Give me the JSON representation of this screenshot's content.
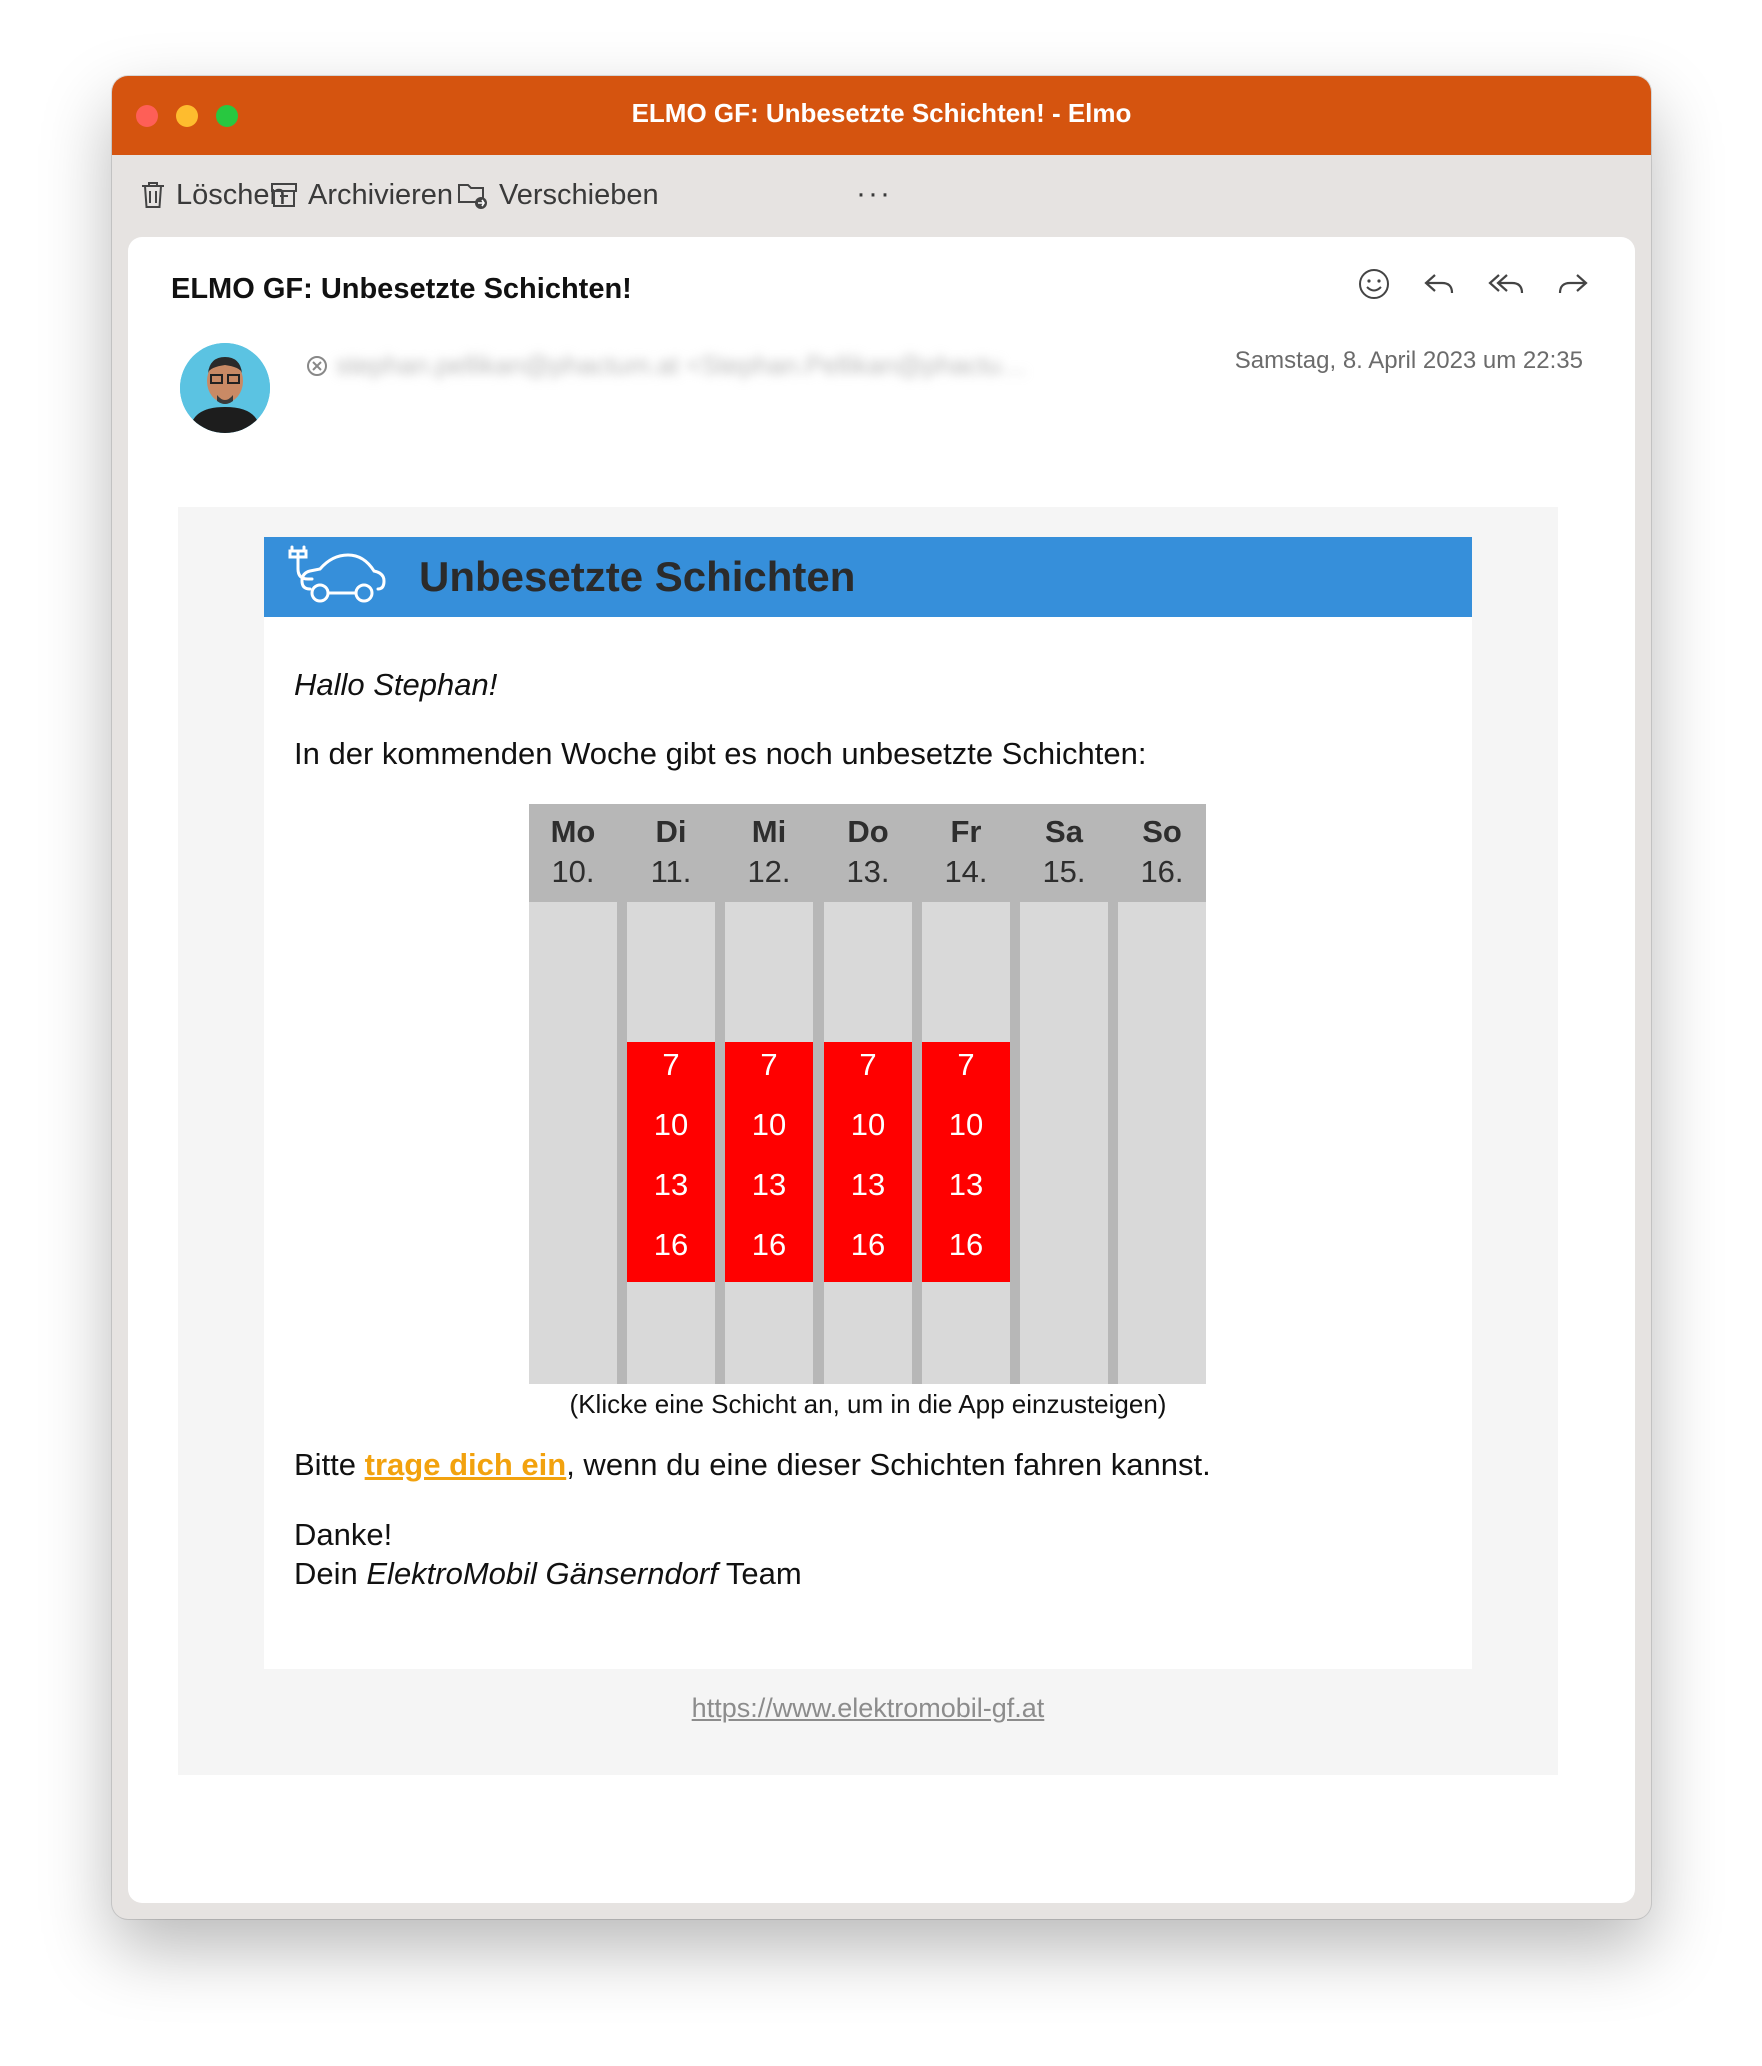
{
  "window": {
    "title": "ELMO GF: Unbesetzte Schichten! - Elmo"
  },
  "toolbar": {
    "delete_label": "Löschen",
    "archive_label": "Archivieren",
    "move_label": "Verschieben",
    "more_label": "···"
  },
  "message": {
    "subject": "ELMO GF: Unbesetzte Schichten!",
    "sender": "stephan.pellikan@phactum.at <Stephan.Pellikan@phactu…",
    "date": "Samstag, 8. April 2023 um 22:35"
  },
  "email": {
    "banner_title": "Unbesetzte Schichten",
    "greeting": "Hallo Stephan!",
    "intro": "In der kommenden Woche gibt es noch unbesetzte Schichten:",
    "caption": "(Klicke eine Schicht an, um in die App einzusteigen)",
    "bitte_prefix": "Bitte ",
    "bitte_link": "trage dich ein",
    "bitte_suffix": ", wenn du eine dieser Schichten fahren kannst.",
    "thanks": "Danke!",
    "sign_prefix": "Dein ",
    "sign_team": "ElektroMobil Gänserndorf",
    "sign_suffix": " Team",
    "footer_url": "https://www.elektromobil-gf.at"
  },
  "calendar": {
    "days": [
      {
        "name": "Mo",
        "date": "10.",
        "shifts": []
      },
      {
        "name": "Di",
        "date": "11.",
        "shifts": [
          "7",
          "10",
          "13",
          "16"
        ]
      },
      {
        "name": "Mi",
        "date": "12.",
        "shifts": [
          "7",
          "10",
          "13",
          "16"
        ]
      },
      {
        "name": "Do",
        "date": "13.",
        "shifts": [
          "7",
          "10",
          "13",
          "16"
        ]
      },
      {
        "name": "Fr",
        "date": "14.",
        "shifts": [
          "7",
          "10",
          "13",
          "16"
        ]
      },
      {
        "name": "Sa",
        "date": "15.",
        "shifts": []
      },
      {
        "name": "So",
        "date": "16.",
        "shifts": []
      }
    ]
  },
  "colors": {
    "titlebar": "#d5540f",
    "banner": "#368fda",
    "shift": "#ff0000",
    "link": "#f2a20e"
  },
  "icons": [
    "trash-icon",
    "archive-icon",
    "move-folder-icon",
    "emoji-icon",
    "reply-icon",
    "reply-all-icon",
    "forward-icon",
    "remove-sender-icon",
    "electric-car-icon"
  ]
}
